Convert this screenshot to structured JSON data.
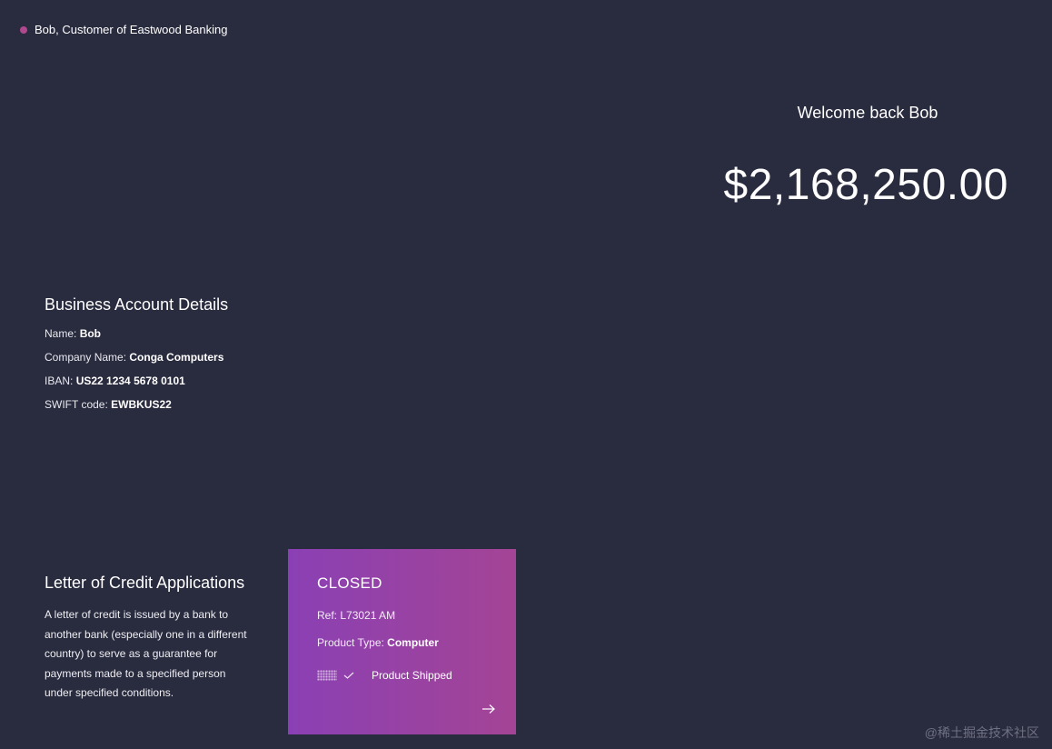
{
  "header": {
    "user_label": "Bob, Customer of Eastwood Banking"
  },
  "summary": {
    "welcome": "Welcome back Bob",
    "balance": "$2,168,250.00"
  },
  "account": {
    "title": "Business Account Details",
    "rows": [
      {
        "label": "Name: ",
        "value": "Bob"
      },
      {
        "label": "Company Name: ",
        "value": "Conga Computers"
      },
      {
        "label": "IBAN: ",
        "value": "US22 1234 5678 0101"
      },
      {
        "label": "SWIFT code: ",
        "value": "EWBKUS22"
      }
    ]
  },
  "letter_of_credit": {
    "title": "Letter of Credit Applications",
    "description": "A letter of credit is issued by a bank to another bank (especially one in a different country) to serve as a guarantee for payments made to a specified person under specified conditions.",
    "card": {
      "status": "CLOSED",
      "ref_label": "Ref: ",
      "ref_value": "L73021 AM",
      "product_label": "Product Type: ",
      "product_value": "Computer",
      "stage": "Product Shipped",
      "icons": [
        "progress-dots-icon",
        "check-icon",
        "arrow-right-icon"
      ]
    }
  },
  "watermark": "@稀土掘金技术社区",
  "colors": {
    "background": "#292b3e",
    "status_dot": "#b0488e",
    "card_gradient_start": "#8a40b4",
    "card_gradient_end": "#a44495"
  }
}
